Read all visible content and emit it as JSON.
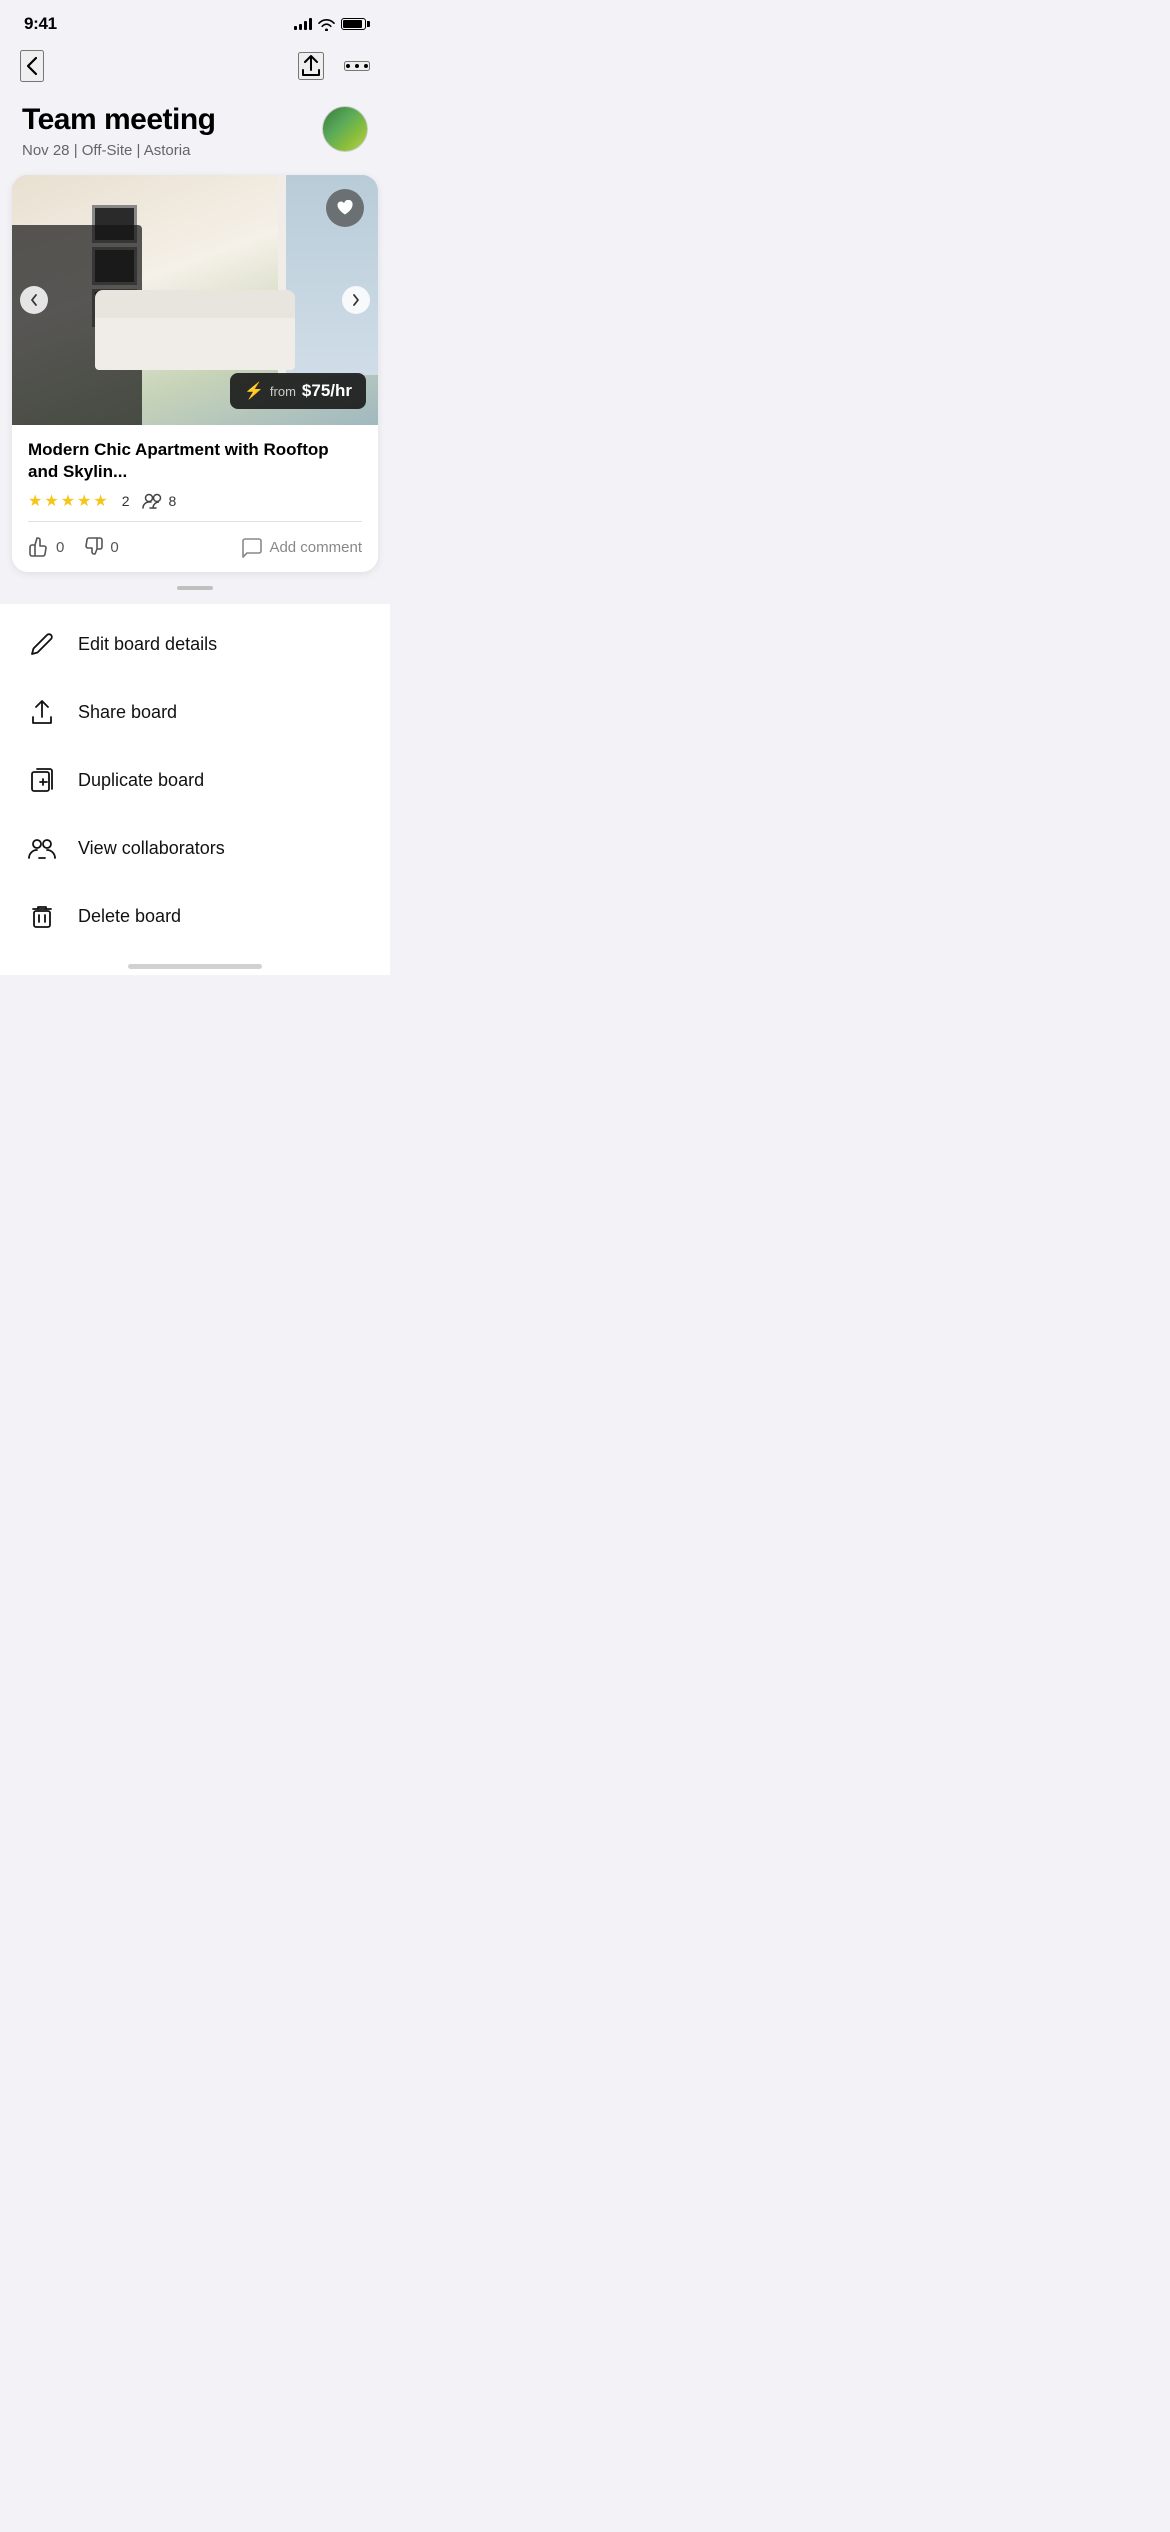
{
  "statusBar": {
    "time": "9:41"
  },
  "nav": {
    "backLabel": "‹",
    "shareIcon": "share",
    "moreIcon": "•••"
  },
  "header": {
    "title": "Team meeting",
    "subtitle": "Nov 28 | Off-Site | Astoria"
  },
  "venue": {
    "title": "Modern Chic Apartment with Rooftop and Skylin...",
    "price": "$75/hr",
    "pricePrefix": "from",
    "rating": 5,
    "reviewCount": "2",
    "capacity": "8",
    "likes": "0",
    "dislikes": "0",
    "addCommentLabel": "Add comment"
  },
  "menu": {
    "items": [
      {
        "id": "edit",
        "label": "Edit board details",
        "icon": "pencil"
      },
      {
        "id": "share",
        "label": "Share board",
        "icon": "share-up"
      },
      {
        "id": "duplicate",
        "label": "Duplicate board",
        "icon": "duplicate"
      },
      {
        "id": "collaborators",
        "label": "View collaborators",
        "icon": "collaborators"
      },
      {
        "id": "delete",
        "label": "Delete board",
        "icon": "trash"
      }
    ]
  }
}
